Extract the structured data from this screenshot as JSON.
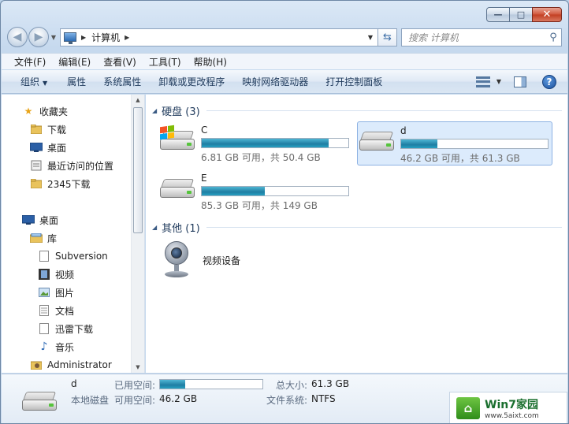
{
  "window": {
    "address": {
      "crumb": "计算机"
    },
    "search": {
      "placeholder": "搜索 计算机"
    }
  },
  "menu": [
    "文件(F)",
    "编辑(E)",
    "查看(V)",
    "工具(T)",
    "帮助(H)"
  ],
  "commands": {
    "organize": "组织",
    "properties": "属性",
    "system_properties": "系统属性",
    "uninstall": "卸载或更改程序",
    "map_drive": "映射网络驱动器",
    "control_panel": "打开控制面板"
  },
  "nav": {
    "favorites": {
      "label": "收藏夹",
      "items": [
        "下载",
        "桌面",
        "最近访问的位置",
        "2345下载"
      ]
    },
    "desktop": "桌面",
    "library": "库",
    "library_items": [
      "Subversion",
      "视频",
      "图片",
      "文档",
      "迅雷下载",
      "音乐"
    ],
    "admin": "Administrator"
  },
  "groups": {
    "hdd": "硬盘 (3)",
    "other": "其他 (1)"
  },
  "drives": [
    {
      "label": "C",
      "free": "6.81 GB 可用，共 50.4 GB",
      "used_fraction": 0.865
    },
    {
      "label": "d",
      "free": "46.2 GB 可用，共 61.3 GB",
      "used_fraction": 0.246
    },
    {
      "label": "E",
      "free": "85.3 GB 可用，共 149 GB",
      "used_fraction": 0.428
    }
  ],
  "devices": [
    {
      "label": "视频设备"
    }
  ],
  "details": {
    "name": "d",
    "type": "本地磁盘",
    "used_key": "已用空间:",
    "free_key": "可用空间:",
    "free_val": "46.2 GB",
    "total_key": "总大小:",
    "total_val": "61.3 GB",
    "fs_key": "文件系统:",
    "fs_val": "NTFS",
    "used_fraction": 0.246
  },
  "watermark": {
    "brand": "Win7家园",
    "url": "www.5aixt.com"
  },
  "colors": {
    "accent": "#1f7ea3",
    "selection": "#dcebfc"
  }
}
